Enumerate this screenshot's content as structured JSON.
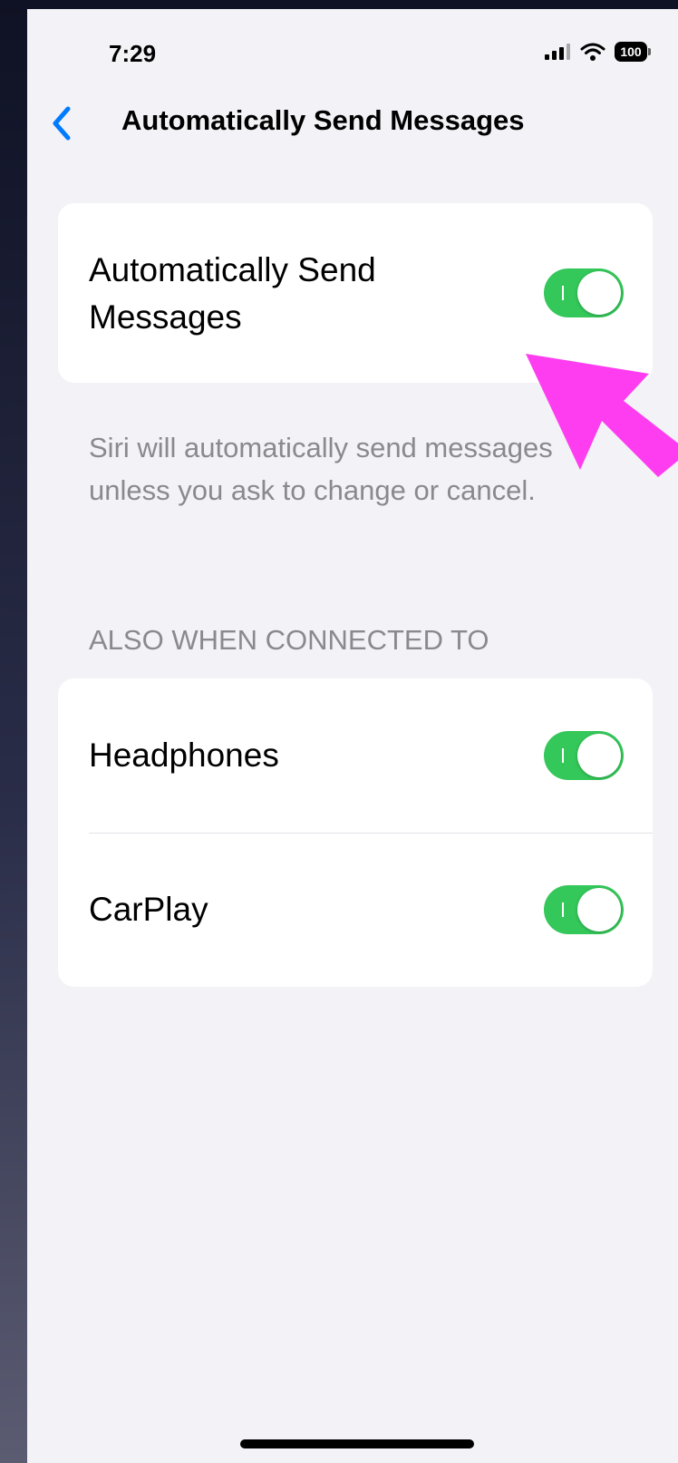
{
  "status_bar": {
    "time": "7:29",
    "battery_level": "100"
  },
  "nav": {
    "title": "Automatically Send Messages",
    "back_icon": "chevron-left-icon"
  },
  "main_setting": {
    "label": "Automatically Send Messages",
    "enabled": true
  },
  "description": "Siri will automatically send messages unless you ask to change or cancel.",
  "connected_section": {
    "header": "ALSO WHEN CONNECTED TO",
    "items": [
      {
        "label": "Headphones",
        "enabled": true
      },
      {
        "label": "CarPlay",
        "enabled": true
      }
    ]
  },
  "colors": {
    "accent": "#007aff",
    "toggle_on": "#34c759",
    "annotation_arrow": "#ff3df0",
    "background": "#f2f2f7"
  }
}
